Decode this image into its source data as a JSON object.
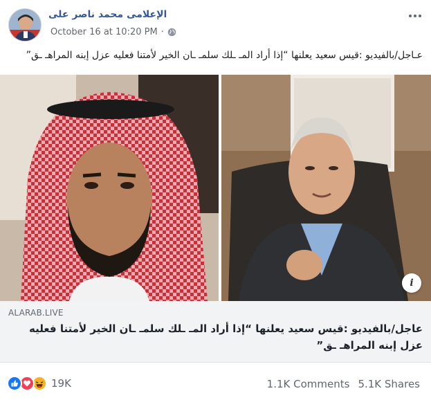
{
  "post": {
    "author": "الإعلامى محمد ناصر على",
    "timestamp": "October 16 at 10:20 PM",
    "separator": "·",
    "privacy_icon": "globe-icon",
    "more_icon": "more-options-icon",
    "caption": "عـاجل/بالفيديو :قيس سعيد يعلنها “إذا أراد المـ ـلك سلمـ ـان الخير لأمتنا فعليه عزل إبنه المراهـ ـق”"
  },
  "link": {
    "domain": "ALARAB.LIVE",
    "title": "عاجل/بالفيديو :قيس سعيد يعلنها “إذا أراد المـ ـلك سلمـ ـان الخير لأمتنا فعليه عزل إبنه المراهـ ـق”",
    "info_label": "i"
  },
  "footer": {
    "reaction_icons": [
      "like-icon",
      "love-icon",
      "haha-icon"
    ],
    "reaction_count": "19K",
    "comments": "1.1K Comments",
    "shares": "5.1K Shares"
  },
  "colors": {
    "author_link": "#385898",
    "like": "#1877f2",
    "love": "#f33e58",
    "haha": "#f7b125",
    "card_bg": "#f2f3f5"
  }
}
